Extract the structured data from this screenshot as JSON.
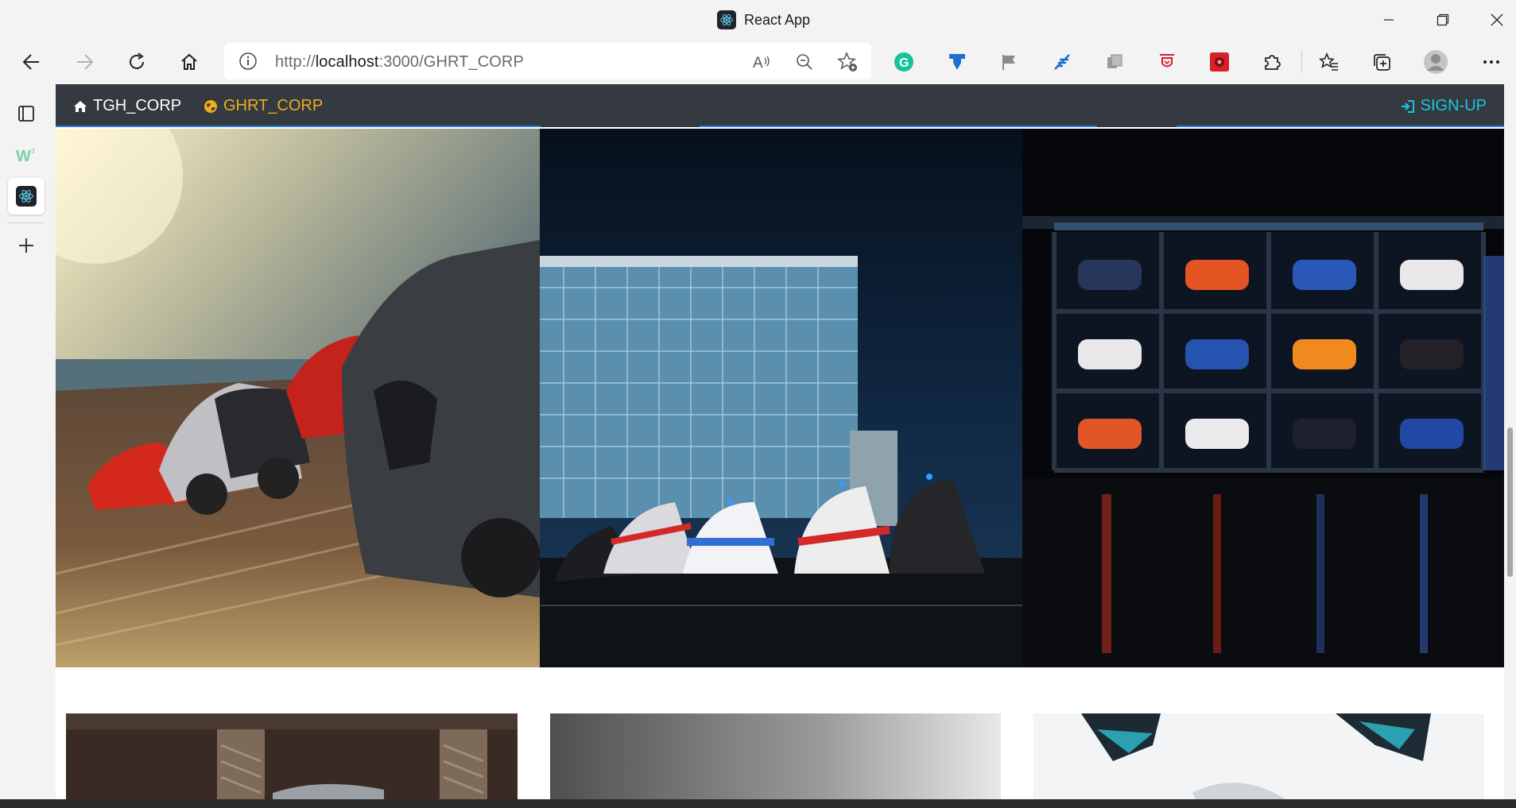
{
  "window": {
    "title": "React App",
    "controls": [
      "minimize-icon",
      "restore-icon",
      "close-icon"
    ]
  },
  "toolbar": {
    "url_prefix": "http://",
    "url_host": "localhost",
    "url_rest": ":3000/GHRT_CORP",
    "buttons": [
      "back-icon",
      "forward-icon",
      "refresh-icon",
      "home-icon"
    ],
    "address_icons": [
      "site-info-icon",
      "read-aloud-icon",
      "zoom-out-icon",
      "add-favorite-icon"
    ],
    "extensions": [
      "grammarly-icon",
      "extension-blue-icon",
      "flag-icon",
      "extension-feather-icon",
      "extension-grey-icon",
      "extension-red-outline-icon",
      "extension-red-icon",
      "puzzle-icon"
    ],
    "right_icons": [
      "favorites-icon",
      "collections-icon",
      "profile-avatar-icon",
      "more-icon"
    ],
    "colors": {
      "grammarly": "#15c39a",
      "blue_ext": "#1f6fd1",
      "red_ext": "#d6202a"
    }
  },
  "sidebar": {
    "items": [
      "tab-actions-icon",
      "w-extension-icon",
      "react-tab-icon",
      "add-tab-icon"
    ]
  },
  "page": {
    "navbar": {
      "brand": "TGH_CORP",
      "link": "GHRT_CORP",
      "signup": "SIGN-UP",
      "colors": {
        "bg": "#343a40",
        "brand": "#ffffff",
        "link": "#f0ad1c",
        "signup": "#18c7e0"
      }
    },
    "carousel": {
      "slides": [
        "sports-cars-on-coast",
        "police-cars-at-glass-building",
        "suv-showroom-display"
      ]
    },
    "cards": [
      "card-image-1",
      "card-image-2",
      "card-image-3"
    ]
  }
}
